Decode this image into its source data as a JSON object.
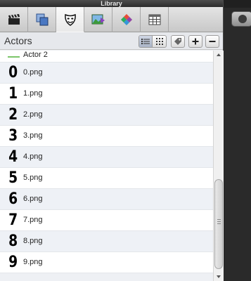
{
  "window": {
    "title": "Library"
  },
  "tabs": [
    {
      "icon": "clapperboard-icon",
      "active": false
    },
    {
      "icon": "layers-icon",
      "active": false
    },
    {
      "icon": "actor-mask-icon",
      "active": true
    },
    {
      "icon": "image-gallery-icon",
      "active": false
    },
    {
      "icon": "palette-icon",
      "active": false
    },
    {
      "icon": "table-icon",
      "active": false
    }
  ],
  "header": {
    "title": "Actors",
    "view_mode": "list"
  },
  "list": {
    "first_item": {
      "label": "Actor 2",
      "line_color": "#7bc56a"
    },
    "items": [
      {
        "glyph": "0",
        "label": "0.png"
      },
      {
        "glyph": "1",
        "label": "1.png"
      },
      {
        "glyph": "2",
        "label": "2.png"
      },
      {
        "glyph": "3",
        "label": "3.png"
      },
      {
        "glyph": "4",
        "label": "4.png"
      },
      {
        "glyph": "5",
        "label": "5.png"
      },
      {
        "glyph": "6",
        "label": "6.png"
      },
      {
        "glyph": "7",
        "label": "7.png"
      },
      {
        "glyph": "8",
        "label": "8.png"
      },
      {
        "glyph": "9",
        "label": "9.png"
      }
    ]
  }
}
